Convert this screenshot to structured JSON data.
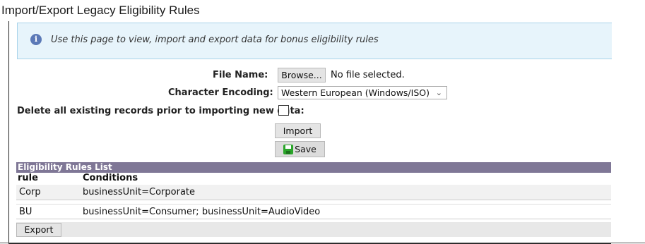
{
  "page": {
    "title": "Import/Export Legacy Eligibility Rules"
  },
  "info": {
    "message": "Use this page to view, import and export data for bonus eligibility rules",
    "icon": "info-icon"
  },
  "form": {
    "file_name_label": "File Name:",
    "browse_label": "Browse...",
    "file_status": "No file selected.",
    "encoding_label": "Character Encoding:",
    "encoding_value": "Western European (Windows/ISO)",
    "delete_label": "Delete all existing records prior to importing new data:",
    "delete_checked": false,
    "import_label": "Import",
    "save_label": "Save"
  },
  "table": {
    "title": "Eligibility Rules List",
    "columns": [
      "rule",
      "Conditions"
    ],
    "rows": [
      {
        "rule": "Corp",
        "conditions": "businessUnit=Corporate"
      },
      {
        "rule": "BU",
        "conditions": "businessUnit=Consumer; businessUnit=AudioVideo"
      }
    ],
    "header_color": "#7f7796"
  },
  "footer": {
    "export_label": "Export"
  }
}
